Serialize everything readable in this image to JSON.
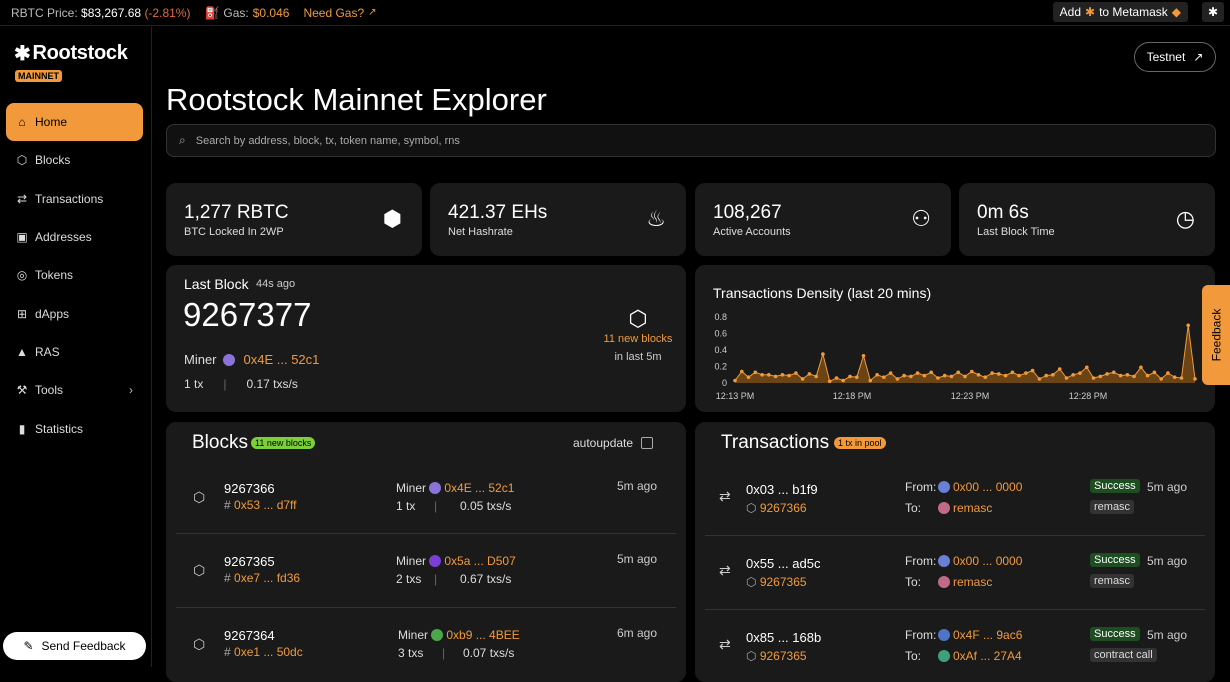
{
  "topbar": {
    "price_label": "RBTC Price:",
    "price_value": "$83,267.68",
    "price_change": "(-2.81%)",
    "gas_label": "Gas:",
    "gas_value": "$0.046",
    "need_gas": "Need Gas?",
    "add_metamask_prefix": "Add",
    "add_metamask_suffix": "to Metamask"
  },
  "brand": {
    "name": "Rootstock",
    "network": "MAINNET"
  },
  "nav": [
    {
      "label": "Home",
      "icon": "home-icon",
      "active": true
    },
    {
      "label": "Blocks",
      "icon": "cube-icon"
    },
    {
      "label": "Transactions",
      "icon": "swap-icon"
    },
    {
      "label": "Addresses",
      "icon": "address-icon"
    },
    {
      "label": "Tokens",
      "icon": "token-icon"
    },
    {
      "label": "dApps",
      "icon": "apps-icon"
    },
    {
      "label": "RAS",
      "icon": "ras-icon"
    },
    {
      "label": "Tools",
      "icon": "wrench-icon"
    },
    {
      "label": "Statistics",
      "icon": "bar-chart-icon"
    }
  ],
  "send_feedback": "Send Feedback",
  "testnet_label": "Testnet",
  "page_title": "Rootstock Mainnet Explorer",
  "search_placeholder": "Search by address, block, tx, token name, symbol, rns",
  "stats": [
    {
      "value": "1,277 RBTC",
      "label": "BTC Locked In 2WP",
      "icon": "bitcoin-icon"
    },
    {
      "value": "421.37 EHs",
      "label": "Net Hashrate",
      "icon": "flame-icon"
    },
    {
      "value": "108,267",
      "label": "Active Accounts",
      "icon": "users-icon"
    },
    {
      "value": "0m 6s",
      "label": "Last Block Time",
      "icon": "clock-icon"
    }
  ],
  "last_block": {
    "title": "Last Block",
    "ago": "44s ago",
    "number": "9267377",
    "miner_label": "Miner",
    "miner": "0x4E ... 52c1",
    "txs": "1 tx",
    "rate": "0.17 txs/s",
    "new_blocks": "11 new blocks",
    "new_blocks_period": "in last 5m"
  },
  "density": {
    "title": "Transactions Density (last 20 mins)"
  },
  "chart_data": {
    "type": "area",
    "title": "Transactions Density (last 20 mins)",
    "ylim": [
      0,
      0.8
    ],
    "yticks": [
      0,
      0.2,
      0.4,
      0.6,
      0.8
    ],
    "xticks": [
      "12:13 PM",
      "12:18 PM",
      "12:23 PM",
      "12:28 PM"
    ],
    "values": [
      0.03,
      0.14,
      0.07,
      0.13,
      0.1,
      0.1,
      0.08,
      0.1,
      0.09,
      0.12,
      0.05,
      0.11,
      0.08,
      0.35,
      0.02,
      0.06,
      0.03,
      0.08,
      0.07,
      0.33,
      0.03,
      0.1,
      0.07,
      0.12,
      0.05,
      0.09,
      0.08,
      0.12,
      0.09,
      0.13,
      0.06,
      0.09,
      0.08,
      0.13,
      0.08,
      0.14,
      0.1,
      0.07,
      0.12,
      0.11,
      0.09,
      0.13,
      0.09,
      0.12,
      0.15,
      0.05,
      0.09,
      0.1,
      0.17,
      0.06,
      0.1,
      0.12,
      0.19,
      0.06,
      0.08,
      0.11,
      0.13,
      0.09,
      0.1,
      0.08,
      0.19,
      0.09,
      0.13,
      0.05,
      0.12,
      0.07,
      0.06,
      0.7,
      0.05
    ]
  },
  "blocks_panel": {
    "title": "Blocks",
    "badge": "11 new blocks",
    "autoupdate": "autoupdate",
    "rows": [
      {
        "number": "9267366",
        "hash": "0x53 ... d7ff",
        "miner_label": "Miner",
        "miner": "0x4E ... 52c1",
        "txs": "1 tx",
        "rate": "0.05 txs/s",
        "ago": "5m ago"
      },
      {
        "number": "9267365",
        "hash": "0xe7 ... fd36",
        "miner_label": "Miner",
        "miner": "0x5a ... D507",
        "txs": "2 txs",
        "rate": "0.67 txs/s",
        "ago": "5m ago"
      },
      {
        "number": "9267364",
        "hash": "0xe1 ... 50dc",
        "miner_label": "Miner",
        "miner": "0xb9 ... 4BEE",
        "txs": "3 txs",
        "rate": "0.07 txs/s",
        "ago": "6m ago"
      }
    ]
  },
  "tx_panel": {
    "title": "Transactions",
    "badge": "1 tx in pool",
    "rows": [
      {
        "hash": "0x03 ... b1f9",
        "block": "9267366",
        "from_label": "From:",
        "from": "0x00 ... 0000",
        "to_label": "To:",
        "to": "remasc",
        "status": "Success",
        "type": "remasc",
        "ago": "5m ago"
      },
      {
        "hash": "0x55 ... ad5c",
        "block": "9267365",
        "from_label": "From:",
        "from": "0x00 ... 0000",
        "to_label": "To:",
        "to": "remasc",
        "status": "Success",
        "type": "remasc",
        "ago": "5m ago"
      },
      {
        "hash": "0x85 ... 168b",
        "block": "9267365",
        "from_label": "From:",
        "from": "0x4F ... 9ac6",
        "to_label": "To:",
        "to": "0xAf ... 27A4",
        "status": "Success",
        "type": "contract call",
        "ago": "5m ago"
      }
    ]
  },
  "feedback_tab": "Feedback",
  "colors": {
    "accent": "#f29a3b",
    "card": "#1a1a1a",
    "success": "#1e4d21"
  }
}
